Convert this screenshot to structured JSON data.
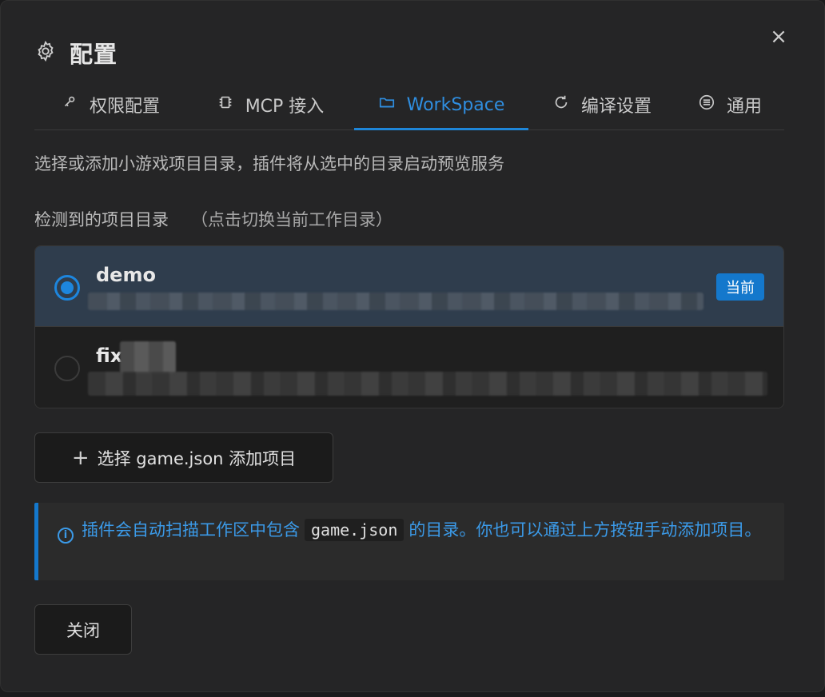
{
  "dialog": {
    "title": "配置",
    "close_symbol": "×"
  },
  "tabs": [
    {
      "label": "权限配置",
      "icon": "key-icon",
      "active": false
    },
    {
      "label": "MCP 接入",
      "icon": "chip-icon",
      "active": false
    },
    {
      "label": "WorkSpace",
      "icon": "folder-icon",
      "active": true
    },
    {
      "label": "编译设置",
      "icon": "refresh-icon",
      "active": false
    },
    {
      "label": "通用",
      "icon": "list-icon",
      "active": false
    }
  ],
  "description": "选择或添加小游戏项目目录，插件将从选中的目录启动预览服务",
  "section": {
    "label": "检测到的项目目录",
    "hint": "（点击切换当前工作目录）"
  },
  "projects": [
    {
      "name": "demo",
      "selected": true,
      "badge": "当前"
    },
    {
      "name": "fix",
      "selected": false
    }
  ],
  "add_button": {
    "plus": "+",
    "label": "选择 game.json 添加项目"
  },
  "info": {
    "icon": "i",
    "text_before": "插件会自动扫描工作区中包含",
    "code": "game.json",
    "text_after": "的目录。你也可以通过上方按钮手动添加项目。"
  },
  "footer": {
    "close_label": "关闭"
  },
  "colors": {
    "accent": "#1e86d8",
    "background": "#252526"
  }
}
